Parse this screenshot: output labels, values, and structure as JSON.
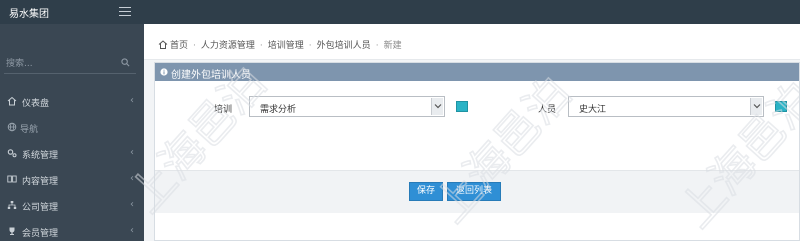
{
  "header": {
    "brand": "易水集团"
  },
  "sidebar": {
    "search_placeholder": "搜索...",
    "items": [
      {
        "label": "仪表盘",
        "icon": "home-icon",
        "has_arrow": true
      },
      {
        "label": "导航",
        "icon": "globe-icon",
        "has_arrow": false
      },
      {
        "label": "系统管理",
        "icon": "gears-icon",
        "has_arrow": true
      },
      {
        "label": "内容管理",
        "icon": "content-icon",
        "has_arrow": true
      },
      {
        "label": "公司管理",
        "icon": "org-chart-icon",
        "has_arrow": true
      },
      {
        "label": "会员管理",
        "icon": "trophy-icon",
        "has_arrow": true
      }
    ]
  },
  "breadcrumb": [
    "首页",
    "人力资源管理",
    "培训管理",
    "外包培训人员",
    "新建"
  ],
  "panel": {
    "title": "创建外包培训人员",
    "training_label": "培训",
    "training_value": "需求分析",
    "person_label": "人员",
    "person_value": "史大江",
    "save_label": "保存",
    "back_label": "返回列表"
  },
  "colors": {
    "topbar": "#2f3e4a",
    "sidebar": "#3a4753",
    "panel_header": "#7e95ae",
    "primary_button": "#2f8fd5",
    "picker_button": "#2ab3c6"
  },
  "watermark": "上海邑泊"
}
